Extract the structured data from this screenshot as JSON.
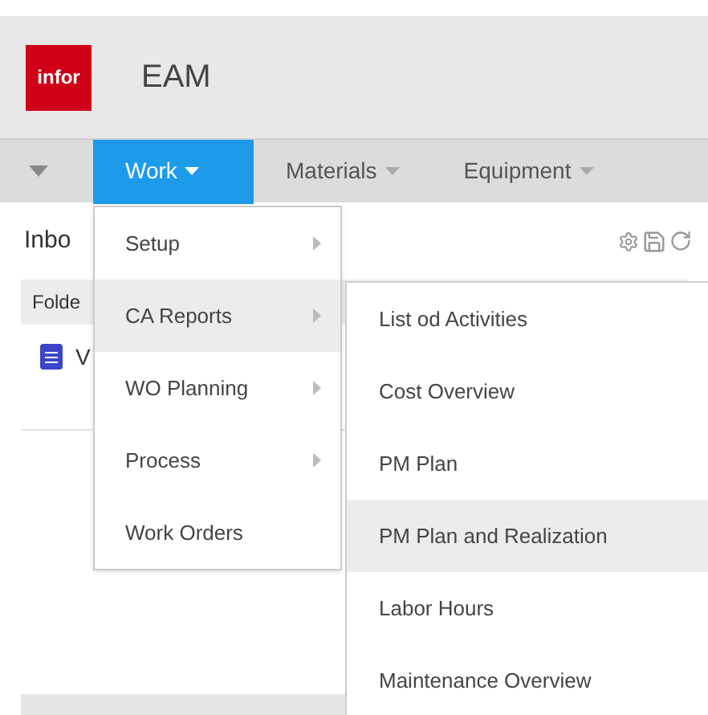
{
  "header": {
    "logo": "infor",
    "title": "EAM"
  },
  "nav": [
    {
      "label": "Work",
      "selected": true
    },
    {
      "label": "Materials",
      "selected": false
    },
    {
      "label": "Equipment",
      "selected": false
    }
  ],
  "panel": {
    "title": "Inbo",
    "column_1": "Folde",
    "rows": [
      {
        "text": "V"
      }
    ]
  },
  "menu": [
    {
      "label": "Setup",
      "submenu": true,
      "selected": false
    },
    {
      "label": "CA Reports",
      "submenu": true,
      "selected": true
    },
    {
      "label": "WO Planning",
      "submenu": true,
      "selected": false
    },
    {
      "label": "Process",
      "submenu": true,
      "selected": false
    },
    {
      "label": "Work Orders",
      "submenu": false,
      "selected": false
    }
  ],
  "submenu": [
    {
      "label": "List od Activities",
      "selected": false
    },
    {
      "label": "Cost Overview",
      "selected": false
    },
    {
      "label": "PM Plan",
      "selected": false
    },
    {
      "label": "PM Plan and Realization",
      "selected": true
    },
    {
      "label": "Labor Hours",
      "selected": false
    },
    {
      "label": "Maintenance Overview",
      "selected": false
    }
  ]
}
